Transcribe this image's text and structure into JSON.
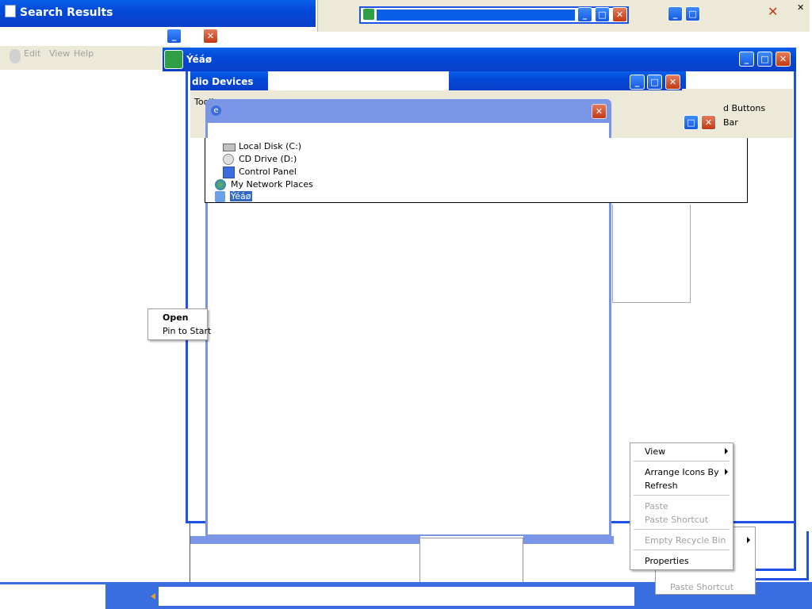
{
  "search_window": {
    "title": "Search Results",
    "menu": [
      "Edit",
      "View",
      "Help"
    ]
  },
  "main_window": {
    "title": "Ýéáø"
  },
  "audio_window": {
    "title": "dio Devices",
    "toolbar_label": "Toolba"
  },
  "taskbar_panel": {
    "buttons_label": "d Buttons",
    "bar_label": "Bar"
  },
  "explorer_popup": {
    "items": [
      {
        "label": "Local Disk (C:)",
        "icon": "hard-disk-icon"
      },
      {
        "label": "CD Drive (D:)",
        "icon": "cd-drive-icon"
      },
      {
        "label": "Control Panel",
        "icon": "control-panel-icon"
      },
      {
        "label": "My Network Places",
        "icon": "network-places-icon"
      },
      {
        "label": "Ýéáø",
        "icon": "recycle-bin-icon",
        "selected": true
      }
    ]
  },
  "start_context_menu": {
    "open_label": "Open",
    "pin_label": "Pin to Start"
  },
  "desktop_context_menu": {
    "view_label": "View",
    "arrange_label": "Arrange Icons By",
    "refresh_label": "Refresh",
    "paste_label": "Paste",
    "paste_shortcut_label": "Paste Shortcut",
    "empty_recycle_label": "Empty Recycle Bin",
    "properties_label": "Properties"
  },
  "ghost_menu": {
    "paste_shortcut_label": "Paste Shortcut"
  },
  "colors": {
    "xp_blue": "#0a5fe8",
    "frame_blue": "#1c52e6",
    "close_red": "#c23a13",
    "selection": "#316ac5"
  }
}
